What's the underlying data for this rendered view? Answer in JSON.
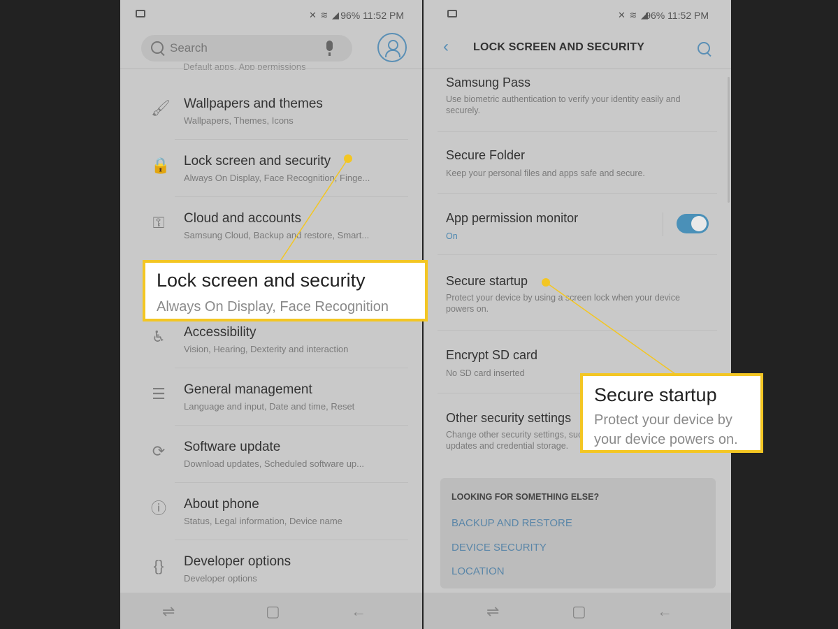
{
  "left_screen": {
    "status": {
      "text": "96% 11:52 PM"
    },
    "search": {
      "placeholder": "Search"
    },
    "cut_text": "Default apps, App permissions",
    "items": [
      {
        "title": "Wallpapers and themes",
        "subtitle": "Wallpapers, Themes, Icons",
        "icon": "paintbrush-icon"
      },
      {
        "title": "Lock screen and security",
        "subtitle": "Always On Display, Face Recognition, Finge...",
        "icon": "lock-icon"
      },
      {
        "title": "Cloud and accounts",
        "subtitle": "Samsung Cloud, Backup and restore, Smart...",
        "icon": "key-icon"
      },
      {
        "title": "Accessibility",
        "subtitle": "Vision, Hearing, Dexterity and interaction",
        "icon": "accessibility-icon"
      },
      {
        "title": "General management",
        "subtitle": "Language and input, Date and time, Reset",
        "icon": "sliders-icon"
      },
      {
        "title": "Software update",
        "subtitle": "Download updates, Scheduled software up...",
        "icon": "update-icon"
      },
      {
        "title": "About phone",
        "subtitle": "Status, Legal information, Device name",
        "icon": "info-icon"
      },
      {
        "title": "Developer options",
        "subtitle": "Developer options",
        "icon": "braces-icon"
      }
    ]
  },
  "right_screen": {
    "status": {
      "text": "96% 11:52 PM"
    },
    "header": {
      "title": "LOCK SCREEN AND SECURITY"
    },
    "items": [
      {
        "title": "Samsung Pass",
        "subtitle": "Use biometric authentication to verify your identity easily and securely."
      },
      {
        "title": "Secure Folder",
        "subtitle": "Keep your personal files and apps safe and secure."
      },
      {
        "title": "App permission monitor",
        "subtitle": "On"
      },
      {
        "title": "Secure startup",
        "subtitle": "Protect your device by using a screen lock when your device powers on."
      },
      {
        "title": "Encrypt SD card",
        "subtitle": "No SD card inserted"
      },
      {
        "title": "Other security settings",
        "subtitle": "Change other security settings, such as those for security updates and credential storage."
      }
    ],
    "card": {
      "heading": "LOOKING FOR SOMETHING ELSE?",
      "links": [
        "BACKUP AND RESTORE",
        "DEVICE SECURITY",
        "LOCATION"
      ]
    }
  },
  "callouts": {
    "left": {
      "title": "Lock screen and security",
      "subtitle": "Always On Display, Face Recognition"
    },
    "right": {
      "title": "Secure startup",
      "subtitle_line1": "Protect your device by",
      "subtitle_line2": "your device powers on."
    }
  },
  "colors": {
    "highlight": "#f3c623",
    "accent": "#5a8fb5",
    "screen_dim": "#c9c9c9",
    "background": "#222222"
  }
}
